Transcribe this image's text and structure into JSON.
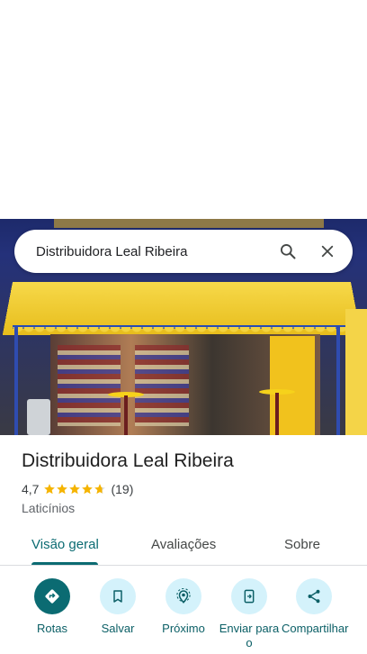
{
  "search": {
    "query": "Distribuidora Leal Ribeira"
  },
  "place": {
    "name": "Distribuidora Leal Ribeira",
    "rating": "4,7",
    "rating_value": 4.7,
    "review_count": "(19)",
    "category": "Laticínios"
  },
  "tabs": [
    {
      "label": "Visão geral",
      "active": true
    },
    {
      "label": "Avaliações",
      "active": false
    },
    {
      "label": "Sobre",
      "active": false
    }
  ],
  "actions": [
    {
      "label": "Rotas",
      "icon": "directions-icon"
    },
    {
      "label": "Salvar",
      "icon": "bookmark-icon"
    },
    {
      "label": "Próximo",
      "icon": "nearby-icon"
    },
    {
      "label": "Enviar para o",
      "icon": "send-to-phone-icon"
    },
    {
      "label": "Compartilhar",
      "icon": "share-icon"
    }
  ],
  "colors": {
    "accent": "#0b6b72",
    "action_bg": "#d4f2fb",
    "star": "#f5b400"
  }
}
